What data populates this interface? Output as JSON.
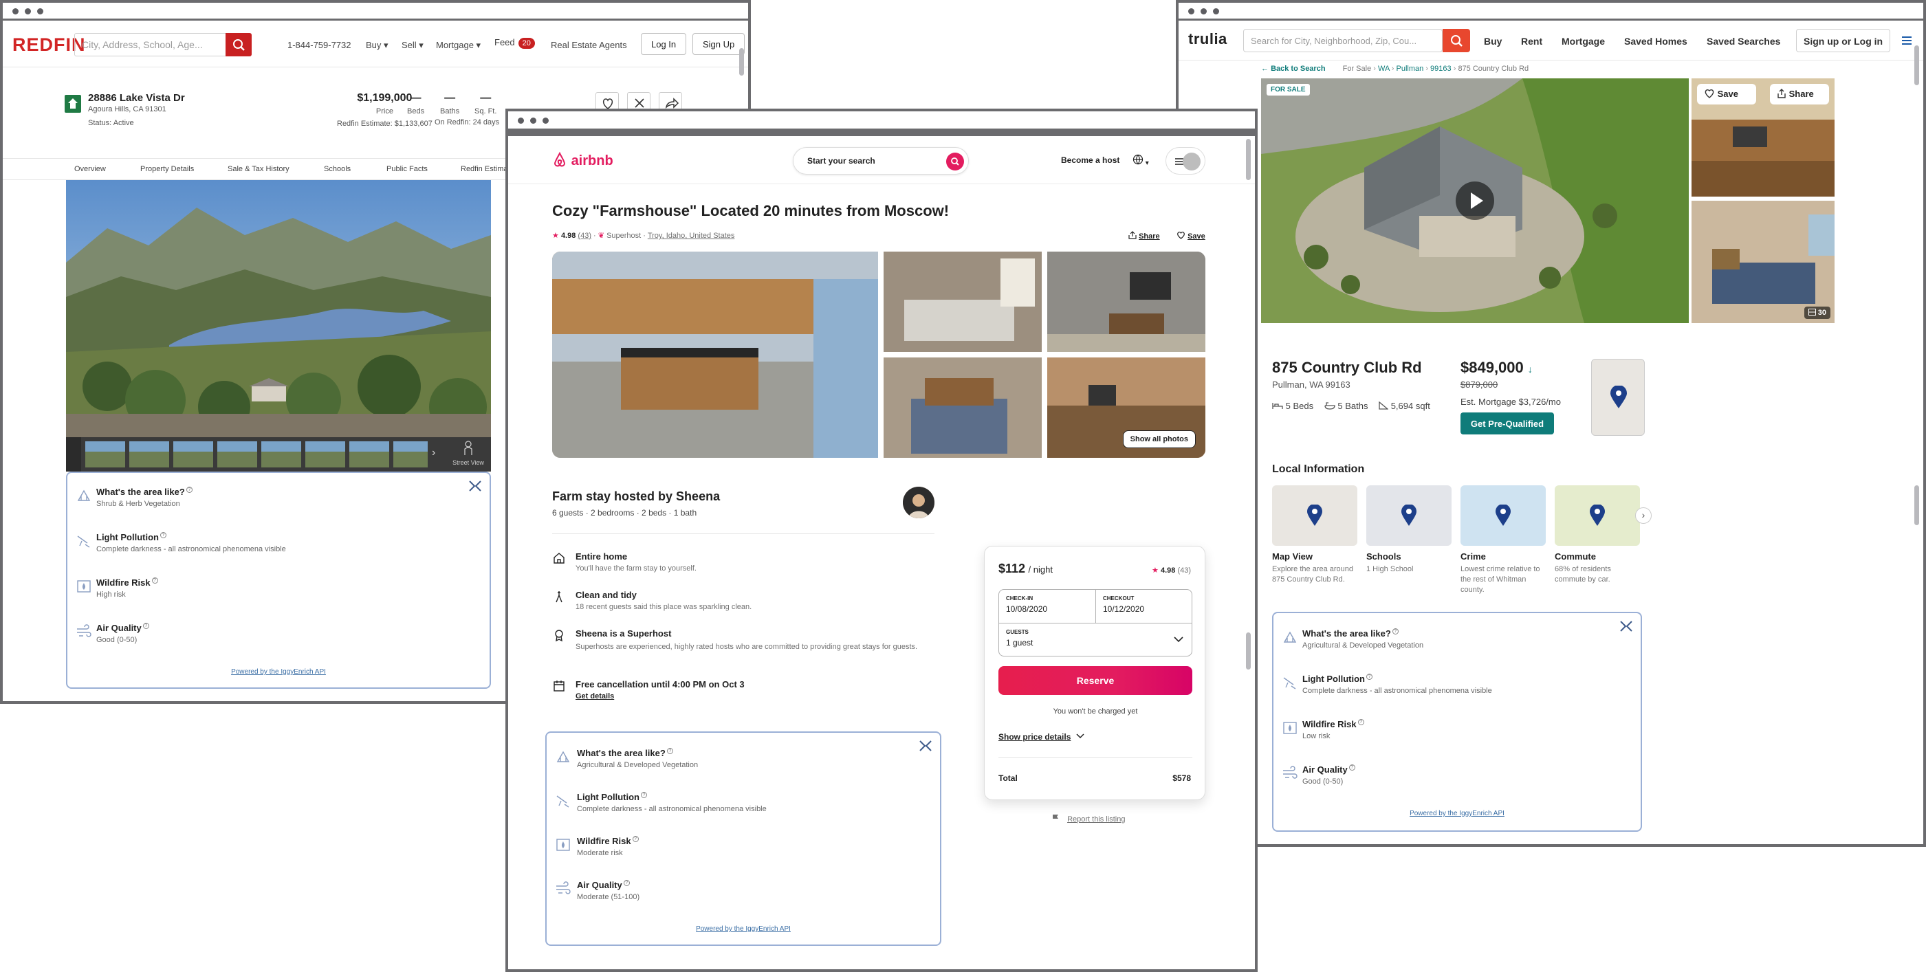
{
  "redfin": {
    "logo": "REDFIN",
    "search_placeholder": "City, Address, School, Age...",
    "phone": "1-844-759-7732",
    "nav": [
      "Buy",
      "Sell",
      "Mortgage"
    ],
    "feed_label": "Feed",
    "feed_count": "20",
    "real_estate_agents": "Real Estate Agents",
    "login": "Log In",
    "signup": "Sign Up",
    "address": "28886 Lake Vista Dr",
    "city": "Agoura Hills, CA 91301",
    "status": "Status: Active",
    "price": "$1,199,000",
    "price_label": "Price",
    "estimate": "Redfin Estimate: $1,133,607",
    "beds_value": "—",
    "beds_label": "Beds",
    "baths_value": "—",
    "baths_label": "Baths",
    "sqft_value": "—",
    "sqft_label": "Sq. Ft.",
    "on_redfin": "On Redfin: 24 days",
    "tabs": [
      "Overview",
      "Property Details",
      "Sale & Tax History",
      "Schools",
      "Public Facts",
      "Redfin Estimate"
    ],
    "street_view": "Street View",
    "iggy": {
      "area_title": "What's the area like?",
      "area_value": "Shrub & Herb Vegetation",
      "light_title": "Light Pollution",
      "light_value": "Complete darkness - all astronomical phenomena visible",
      "wildfire_title": "Wildfire Risk",
      "wildfire_value": "High risk",
      "air_title": "Air Quality",
      "air_value": "Good (0-50)",
      "powered": "Powered by the IggyEnrich API"
    }
  },
  "airbnb": {
    "logo": "airbnb",
    "search_placeholder": "Start your search",
    "become_host": "Become a host",
    "title": "Cozy \"Farmshouse\" Located 20 minutes from Moscow!",
    "rating": "4.98",
    "reviews": "(43)",
    "superhost": "Superhost",
    "location": "Troy, Idaho, United States",
    "share": "Share",
    "save": "Save",
    "show_all_photos": "Show all photos",
    "host_heading": "Farm stay hosted by Sheena",
    "host_details": "6 guests · 2 bedrooms · 2 beds · 1 bath",
    "features": [
      {
        "title": "Entire home",
        "desc": "You'll have the farm stay to yourself."
      },
      {
        "title": "Clean and tidy",
        "desc": "18 recent guests said this place was sparkling clean."
      },
      {
        "title": "Sheena is a Superhost",
        "desc": "Superhosts are experienced, highly rated hosts who are committed to providing great stays for guests."
      },
      {
        "title": "Free cancellation until 4:00 PM on Oct 3",
        "desc": "Get details"
      }
    ],
    "booking": {
      "price": "$112",
      "per_night": "/ night",
      "rating": "4.98",
      "reviews": "(43)",
      "checkin_label": "CHECK-IN",
      "checkin_value": "10/08/2020",
      "checkout_label": "CHECKOUT",
      "checkout_value": "10/12/2020",
      "guests_label": "GUESTS",
      "guests_value": "1 guest",
      "reserve": "Reserve",
      "not_charged": "You won't be charged yet",
      "show_price_details": "Show price details",
      "total_label": "Total",
      "total_value": "$578"
    },
    "report": "Report this listing",
    "iggy": {
      "area_title": "What's the area like?",
      "area_value": "Agricultural & Developed Vegetation",
      "light_title": "Light Pollution",
      "light_value": "Complete darkness - all astronomical phenomena visible",
      "wildfire_title": "Wildfire Risk",
      "wildfire_value": "Moderate risk",
      "air_title": "Air Quality",
      "air_value": "Moderate (51-100)",
      "powered": "Powered by the IggyEnrich API"
    }
  },
  "trulia": {
    "logo": "trulia",
    "search_placeholder": "Search for City, Neighborhood, Zip, Cou...",
    "nav": [
      "Buy",
      "Rent",
      "Mortgage",
      "Saved Homes",
      "Saved Searches"
    ],
    "signup": "Sign up or Log in",
    "back": "Back to Search",
    "crumbs": [
      "For Sale",
      "WA",
      "Pullman",
      "99163",
      "875 Country Club Rd"
    ],
    "for_sale": "FOR SALE",
    "save": "Save",
    "share": "Share",
    "photo_count": "30",
    "address": "875 Country Club Rd",
    "city": "Pullman, WA 99163",
    "beds": "5 Beds",
    "baths": "5 Baths",
    "sqft": "5,694 sqft",
    "price": "$849,000",
    "old_price": "$879,000",
    "mortgage": "Est. Mortgage $3,726/mo",
    "prequal": "Get Pre-Qualified",
    "local_info": "Local Information",
    "tiles": [
      {
        "title": "Map View",
        "desc": "Explore the area around 875 Country Club Rd."
      },
      {
        "title": "Schools",
        "desc": "1 High School"
      },
      {
        "title": "Crime",
        "desc": "Lowest crime relative to the rest of Whitman county."
      },
      {
        "title": "Commute",
        "desc": "68% of residents commute by car."
      }
    ],
    "iggy": {
      "area_title": "What's the area like?",
      "area_value": "Agricultural & Developed Vegetation",
      "light_title": "Light Pollution",
      "light_value": "Complete darkness - all astronomical phenomena visible",
      "wildfire_title": "Wildfire Risk",
      "wildfire_value": "Low risk",
      "air_title": "Air Quality",
      "air_value": "Good (0-50)",
      "powered": "Powered by the IggyEnrich API"
    }
  },
  "colors": {
    "redfin_red": "#c82021",
    "airbnb_pink": "#e31c5f",
    "trulia_red": "#e8472e",
    "trulia_teal": "#0f7c7a",
    "iggy_border": "#9bb0d6"
  }
}
